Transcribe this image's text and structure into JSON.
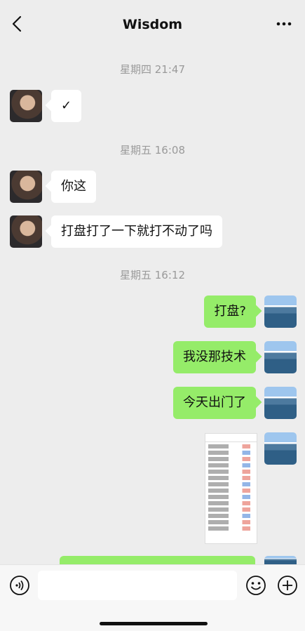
{
  "header": {
    "title": "Wisdom"
  },
  "timestamps": [
    "星期四 21:47",
    "星期五 16:08",
    "星期五 16:12"
  ],
  "messages": {
    "m1": "✓",
    "m2": "你这",
    "m3": "打盘打了一下就打不动了吗",
    "m4": "打盘?",
    "m5": "我没那技术",
    "m6": "今天出门了"
  },
  "icons": {
    "back": "chevron-left-icon",
    "more": "more-dots-icon",
    "voice": "voice-icon",
    "emoji": "emoji-icon",
    "plus": "plus-icon"
  },
  "colors": {
    "background": "#ededed",
    "outgoing_bubble": "#95ec69",
    "incoming_bubble": "#ffffff"
  }
}
